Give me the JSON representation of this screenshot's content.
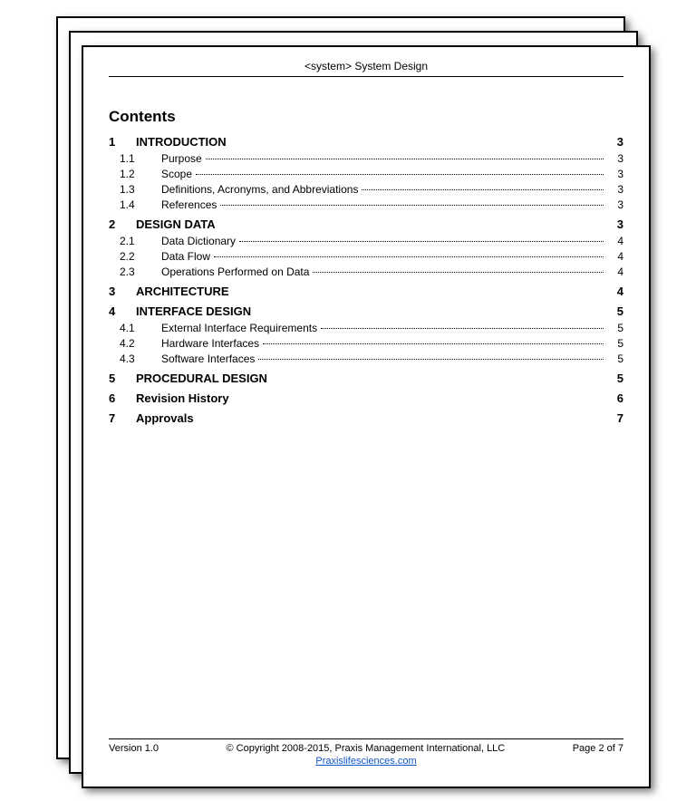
{
  "header": {
    "title": "<system> System Design"
  },
  "contents_label": "Contents",
  "toc": [
    {
      "level": 1,
      "num": "1",
      "title": "INTRODUCTION",
      "page": "3"
    },
    {
      "level": 2,
      "num": "1.1",
      "title": "Purpose",
      "page": "3"
    },
    {
      "level": 2,
      "num": "1.2",
      "title": "Scope",
      "page": "3"
    },
    {
      "level": 2,
      "num": "1.3",
      "title": "Definitions, Acronyms, and Abbreviations",
      "page": "3"
    },
    {
      "level": 2,
      "num": "1.4",
      "title": "References",
      "page": "3"
    },
    {
      "level": 1,
      "num": "2",
      "title": "DESIGN DATA",
      "page": "3"
    },
    {
      "level": 2,
      "num": "2.1",
      "title": "Data Dictionary",
      "page": "4"
    },
    {
      "level": 2,
      "num": "2.2",
      "title": "Data Flow",
      "page": "4"
    },
    {
      "level": 2,
      "num": "2.3",
      "title": "Operations Performed on Data",
      "page": "4"
    },
    {
      "level": 1,
      "num": "3",
      "title": "ARCHITECTURE",
      "page": "4"
    },
    {
      "level": 1,
      "num": "4",
      "title": "INTERFACE DESIGN",
      "page": "5"
    },
    {
      "level": 2,
      "num": "4.1",
      "title": "External Interface Requirements",
      "page": "5"
    },
    {
      "level": 2,
      "num": "4.2",
      "title": "Hardware Interfaces",
      "page": "5"
    },
    {
      "level": 2,
      "num": "4.3",
      "title": "Software Interfaces",
      "page": "5"
    },
    {
      "level": 1,
      "num": "5",
      "title": "PROCEDURAL DESIGN",
      "page": "5"
    },
    {
      "level": 1,
      "num": "6",
      "title": "Revision History",
      "page": "6"
    },
    {
      "level": 1,
      "num": "7",
      "title": "Approvals",
      "page": "7"
    }
  ],
  "footer": {
    "version": "Version 1.0",
    "copyright": "© Copyright 2008-2015, Praxis Management International, LLC",
    "page_info": "Page 2 of 7",
    "link_text": "Praxislifesciences.com"
  }
}
